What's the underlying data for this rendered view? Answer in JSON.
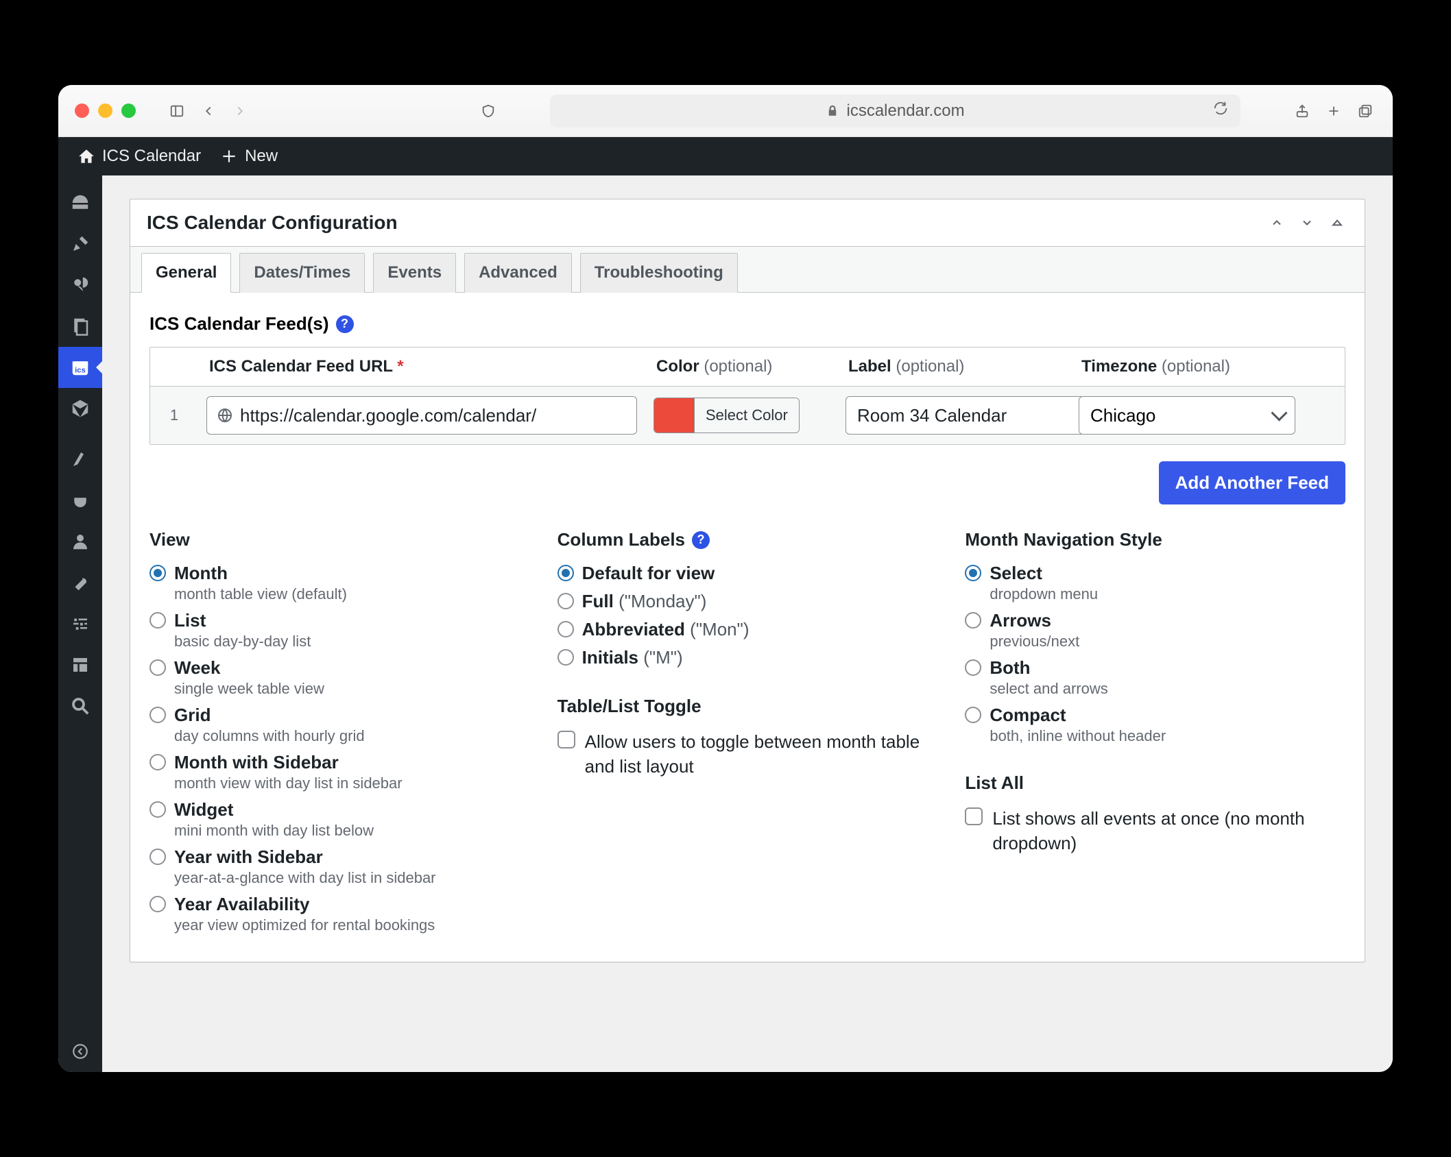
{
  "browser": {
    "domain": "icscalendar.com"
  },
  "adminbar": {
    "site": "ICS Calendar",
    "new": "New"
  },
  "panel": {
    "title": "ICS Calendar Configuration"
  },
  "tabs": [
    "General",
    "Dates/Times",
    "Events",
    "Advanced",
    "Troubleshooting"
  ],
  "feeds": {
    "title": "ICS Calendar Feed(s)",
    "headers": {
      "url": "ICS Calendar Feed URL",
      "color": "Color",
      "label": "Label",
      "tz": "Timezone",
      "optional": "(optional)"
    },
    "row1": {
      "num": "1",
      "url": "https://calendar.google.com/calendar/",
      "colorBtn": "Select Color",
      "colorSwatch": "#ec4a3b",
      "label": "Room 34 Calendar",
      "tz": "Chicago"
    },
    "addBtn": "Add Another Feed"
  },
  "view": {
    "title": "View",
    "opts": [
      {
        "label": "Month",
        "desc": "month table view (default)",
        "sel": true
      },
      {
        "label": "List",
        "desc": "basic day-by-day list"
      },
      {
        "label": "Week",
        "desc": "single week table view"
      },
      {
        "label": "Grid",
        "desc": "day columns with hourly grid"
      },
      {
        "label": "Month with Sidebar",
        "desc": "month view with day list in sidebar"
      },
      {
        "label": "Widget",
        "desc": "mini month with day list below"
      },
      {
        "label": "Year with Sidebar",
        "desc": "year-at-a-glance with day list in sidebar"
      },
      {
        "label": "Year Availability",
        "desc": "year view optimized for rental bookings"
      }
    ]
  },
  "columnLabels": {
    "title": "Column Labels",
    "opts": [
      {
        "label": "Default for view",
        "suffix": "",
        "sel": true
      },
      {
        "label": "Full",
        "suffix": "(\"Monday\")"
      },
      {
        "label": "Abbreviated",
        "suffix": "(\"Mon\")"
      },
      {
        "label": "Initials",
        "suffix": "(\"M\")"
      }
    ]
  },
  "monthNav": {
    "title": "Month Navigation Style",
    "opts": [
      {
        "label": "Select",
        "desc": "dropdown menu",
        "sel": true
      },
      {
        "label": "Arrows",
        "desc": "previous/next"
      },
      {
        "label": "Both",
        "desc": "select and arrows"
      },
      {
        "label": "Compact",
        "desc": "both, inline without header"
      }
    ]
  },
  "toggle": {
    "title": "Table/List Toggle",
    "text": "Allow users to toggle between month table and list layout"
  },
  "listAll": {
    "title": "List All",
    "text": "List shows all events at once (no month dropdown)"
  }
}
